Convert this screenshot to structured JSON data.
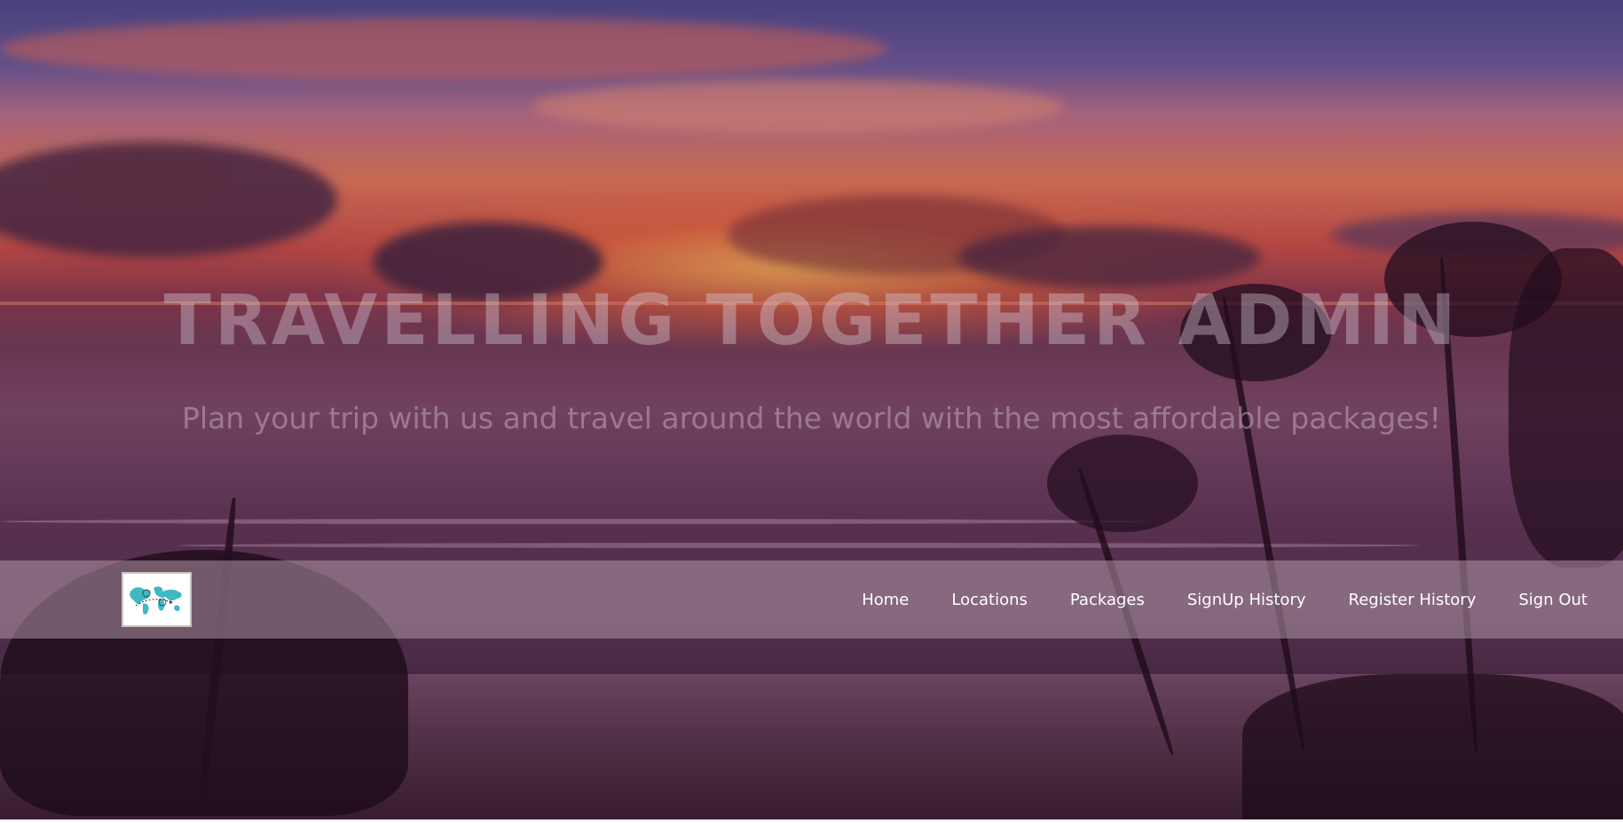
{
  "hero": {
    "title": "TRAVELLING TOGETHER ADMIN",
    "subtitle": "Plan your trip with us and travel around the world with the most affordable packages!"
  },
  "navbar": {
    "logo_icon": "world-map-logo-icon",
    "links": [
      {
        "label": "Home"
      },
      {
        "label": "Locations"
      },
      {
        "label": "Packages"
      },
      {
        "label": "SignUp History"
      },
      {
        "label": "Register History"
      },
      {
        "label": "Sign Out"
      }
    ]
  },
  "colors": {
    "nav_text": "#ffffff",
    "logo_teal": "#3fb8c4"
  }
}
